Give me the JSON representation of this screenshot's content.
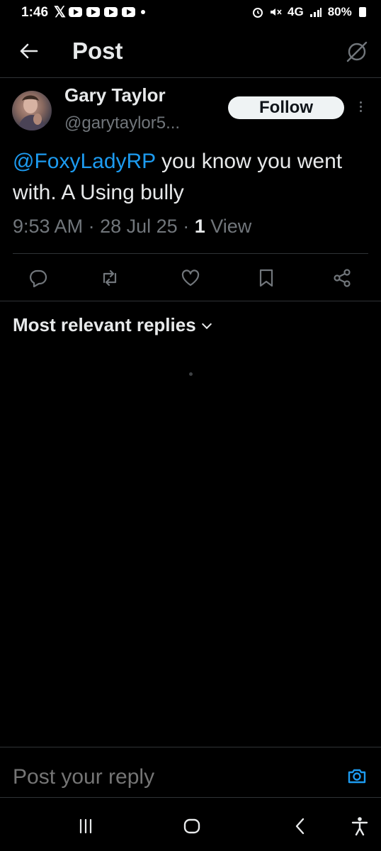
{
  "status_bar": {
    "time": "1:46",
    "x_logo": "𝕏",
    "network": "4G",
    "battery": "80%"
  },
  "header": {
    "title": "Post"
  },
  "post": {
    "author_name": "Gary Taylor",
    "author_handle": "@garytaylor5...",
    "follow_label": "Follow",
    "mention": "@FoxyLadyRP",
    "text": " you know you went with. A Using bully",
    "time": "9:53 AM",
    "date": "28 Jul 25",
    "views_count": "1",
    "views_label": "View"
  },
  "replies": {
    "sort_label": "Most relevant replies"
  },
  "reply_box": {
    "placeholder": "Post your reply"
  },
  "colors": {
    "background": "#000000",
    "accent": "#1d9bf0",
    "text": "#e7e9ea",
    "muted": "#71767b",
    "divider": "#2f3336"
  },
  "icons": [
    "back-arrow-icon",
    "grok-icon",
    "more-options-icon",
    "reply-icon",
    "repost-icon",
    "like-icon",
    "bookmark-icon",
    "share-icon",
    "camera-icon",
    "recent-apps-icon",
    "home-icon",
    "nav-back-icon",
    "accessibility-icon"
  ]
}
